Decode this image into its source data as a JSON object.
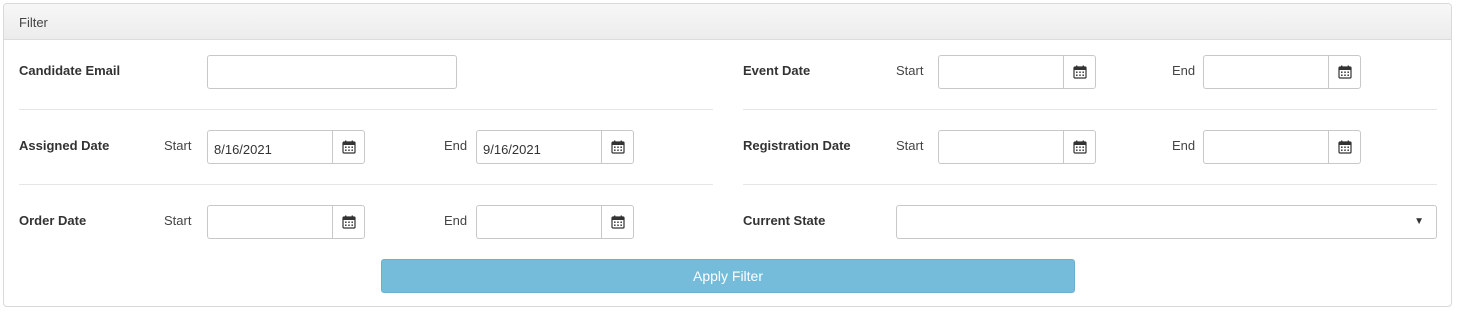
{
  "panel": {
    "title": "Filter"
  },
  "filters": {
    "candidate_email": {
      "label": "Candidate Email",
      "value": "",
      "placeholder": ""
    },
    "assigned_date": {
      "label": "Assigned Date",
      "start_label": "Start",
      "start_value": "8/16/2021",
      "end_label": "End",
      "end_value": "9/16/2021"
    },
    "order_date": {
      "label": "Order Date",
      "start_label": "Start",
      "start_value": "",
      "end_label": "End",
      "end_value": ""
    },
    "event_date": {
      "label": "Event Date",
      "start_label": "Start",
      "start_value": "",
      "end_label": "End",
      "end_value": ""
    },
    "registration_date": {
      "label": "Registration Date",
      "start_label": "Start",
      "start_value": "",
      "end_label": "End",
      "end_value": ""
    },
    "current_state": {
      "label": "Current State",
      "selected": ""
    }
  },
  "actions": {
    "apply_label": "Apply Filter"
  },
  "icons": {
    "calendar": "calendar-icon",
    "dropdown": "caret-down-icon"
  },
  "colors": {
    "apply_button": "#74bcda",
    "apply_text": "#ffffff"
  }
}
